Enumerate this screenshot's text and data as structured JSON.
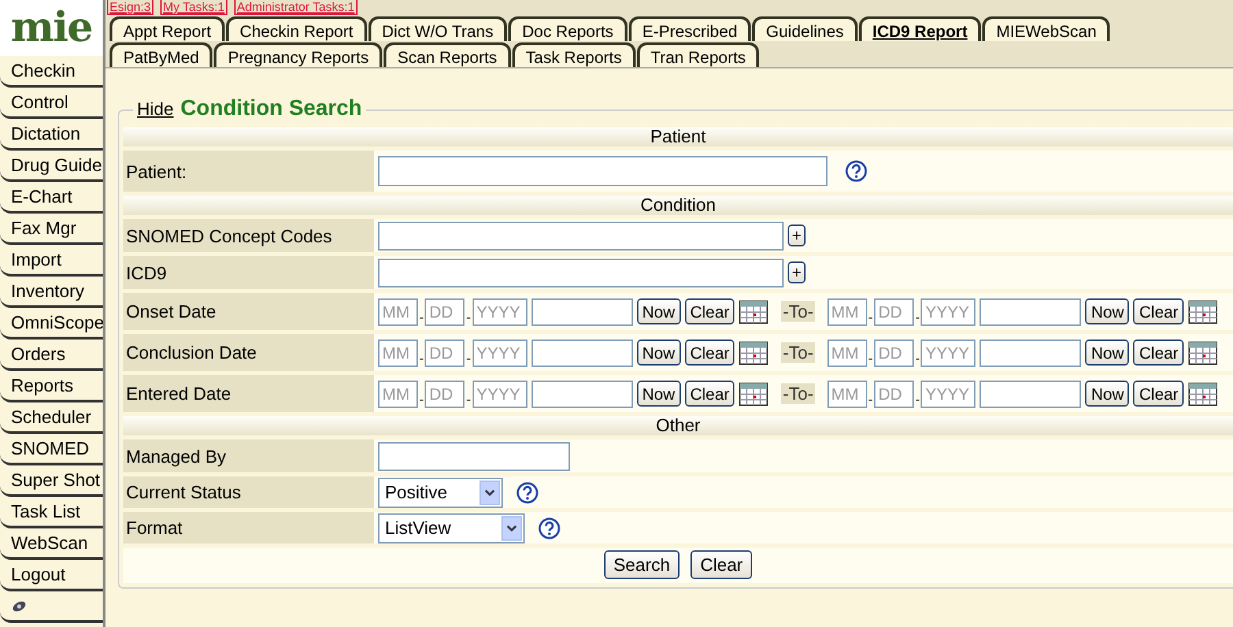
{
  "top_links": [
    "Esign:3",
    "My Tasks:1",
    "Administrator Tasks:1"
  ],
  "logo": {
    "text": "mie"
  },
  "sidebar": {
    "items": [
      {
        "kind": "text",
        "label": "Checkin"
      },
      {
        "kind": "text",
        "label": "Control"
      },
      {
        "kind": "text",
        "label": "Dictation"
      },
      {
        "kind": "text",
        "label": "Drug Guide"
      },
      {
        "kind": "text",
        "label": "E-Chart"
      },
      {
        "kind": "text",
        "label": "Fax Mgr"
      },
      {
        "kind": "text",
        "label": "Import"
      },
      {
        "kind": "text",
        "label": "Inventory"
      },
      {
        "kind": "text",
        "label": "OmniScope"
      },
      {
        "kind": "text",
        "label": "Orders"
      },
      {
        "kind": "text",
        "label": "Reports"
      },
      {
        "kind": "text",
        "label": "Scheduler"
      },
      {
        "kind": "text",
        "label": "SNOMED"
      },
      {
        "kind": "text",
        "label": "Super Shot"
      },
      {
        "kind": "text",
        "label": "Task List"
      },
      {
        "kind": "text",
        "label": "WebScan"
      },
      {
        "kind": "text",
        "label": "Logout"
      },
      {
        "kind": "icon"
      }
    ]
  },
  "tabs": [
    [
      {
        "label": "Appt Report",
        "selected": false
      },
      {
        "label": "Checkin Report",
        "selected": false
      },
      {
        "label": "Dict W/O Trans",
        "selected": false
      },
      {
        "label": "Doc Reports",
        "selected": false
      },
      {
        "label": "E-Prescribed",
        "selected": false
      },
      {
        "label": "Guidelines",
        "selected": false
      },
      {
        "label": "ICD9 Report",
        "selected": true
      },
      {
        "label": "MIEWebScan",
        "selected": false
      }
    ],
    [
      {
        "label": "PatByMed",
        "selected": false
      },
      {
        "label": "Pregnancy Reports",
        "selected": false
      },
      {
        "label": "Scan Reports",
        "selected": false
      },
      {
        "label": "Task Reports",
        "selected": false
      },
      {
        "label": "Tran Reports",
        "selected": false
      }
    ]
  ],
  "panel": {
    "toggle": "Hide",
    "title": "Condition Search",
    "sections": [
      {
        "heading": "Patient",
        "rows": [
          {
            "kind": "text",
            "label": "Patient:",
            "help": true
          }
        ]
      },
      {
        "heading": "Condition",
        "rows": [
          {
            "kind": "text",
            "label": "SNOMED Concept Codes",
            "add_button": "+"
          },
          {
            "kind": "text",
            "label": "ICD9",
            "add_button": "+"
          },
          {
            "kind": "date_range",
            "label": "Onset Date",
            "from": {
              "placeholders": [
                "MM",
                "DD",
                "YYYY"
              ],
              "dashes": [
                "-",
                "-"
              ],
              "buttons": [
                "Now",
                "Clear"
              ]
            },
            "separator": "-To-",
            "to": {
              "placeholders": [
                "MM",
                "DD",
                "YYYY"
              ],
              "dashes": [
                "-",
                "-"
              ],
              "buttons": [
                "Now",
                "Clear"
              ]
            }
          },
          {
            "kind": "date_range",
            "label": "Conclusion Date",
            "from": {
              "placeholders": [
                "MM",
                "DD",
                "YYYY"
              ],
              "dashes": [
                "-",
                "-"
              ],
              "buttons": [
                "Now",
                "Clear"
              ]
            },
            "separator": "-To-",
            "to": {
              "placeholders": [
                "MM",
                "DD",
                "YYYY"
              ],
              "dashes": [
                "-",
                "-"
              ],
              "buttons": [
                "Now",
                "Clear"
              ]
            }
          },
          {
            "kind": "date_range",
            "label": "Entered Date",
            "from": {
              "placeholders": [
                "MM",
                "DD",
                "YYYY"
              ],
              "dashes": [
                "-",
                "-"
              ],
              "buttons": [
                "Now",
                "Clear"
              ]
            },
            "separator": "-To-",
            "to": {
              "placeholders": [
                "MM",
                "DD",
                "YYYY"
              ],
              "dashes": [
                "-",
                "-"
              ],
              "buttons": [
                "Now",
                "Clear"
              ]
            }
          }
        ]
      },
      {
        "heading": "Other",
        "rows": [
          {
            "kind": "text",
            "label": "Managed By"
          },
          {
            "kind": "select",
            "label": "Current Status",
            "value": "Positive",
            "help": true
          },
          {
            "kind": "select",
            "label": "Format",
            "value": "ListView",
            "help": true
          }
        ]
      }
    ],
    "buttons": [
      "Search",
      "Clear"
    ]
  }
}
